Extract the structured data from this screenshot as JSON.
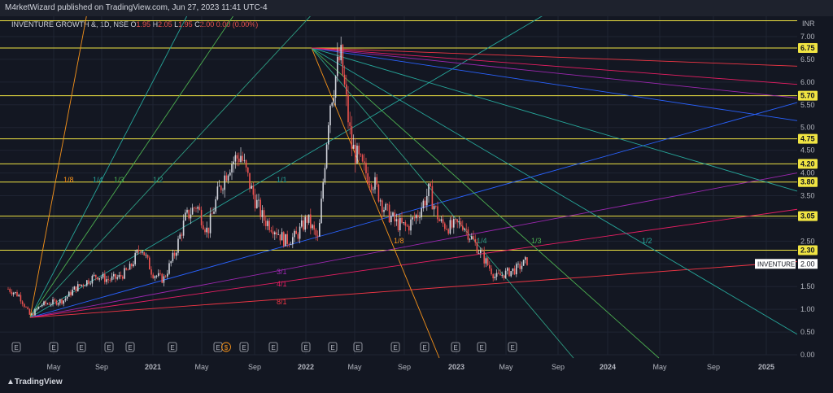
{
  "header": {
    "published": "M4rketWizard published on TradingView.com, Jun 27, 2023 11:41 UTC-4"
  },
  "legend": {
    "symbol": "INVENTURE GROWTH &, 1D, NSE",
    "o_label": "O",
    "o": "1.95",
    "h_label": "H",
    "h": "2.05",
    "l_label": "L",
    "l": "1.95",
    "c_label": "C",
    "c": "2.00",
    "change": "0.00 (0.00%)"
  },
  "footer": {
    "brand": "TradingView"
  },
  "colors": {
    "background": "#131722",
    "up": "#d1d4dc",
    "down": "#ef5350",
    "level": "#f0e442"
  },
  "chart_data": {
    "type": "candlestick",
    "currency": "INR",
    "y_ticks": [
      "0.00",
      "0.50",
      "1.00",
      "1.50",
      "2.00",
      "2.50",
      "3.00",
      "3.50",
      "4.00",
      "4.50",
      "5.00",
      "5.50",
      "6.00",
      "6.50",
      "7.00"
    ],
    "x_ticks": [
      "May",
      "Sep",
      "2021",
      "May",
      "Sep",
      "2022",
      "May",
      "Sep",
      "2023",
      "May",
      "Sep",
      "2024",
      "May",
      "Sep",
      "2025"
    ],
    "ylim": [
      0,
      7.3
    ],
    "grid": true,
    "price_levels": [
      {
        "value": 7.35,
        "label": ""
      },
      {
        "value": 6.75,
        "label": "6.75"
      },
      {
        "value": 5.7,
        "label": "5.70"
      },
      {
        "value": 4.75,
        "label": "4.75"
      },
      {
        "value": 4.2,
        "label": "4.20"
      },
      {
        "value": 3.8,
        "label": "3.80"
      },
      {
        "value": 3.05,
        "label": "3.05"
      },
      {
        "value": 2.3,
        "label": "2.30"
      }
    ],
    "last_price": {
      "symbol": "INVENTURE",
      "value": 2.0,
      "label": "2.00"
    },
    "price_path": [
      1.45,
      1.3,
      0.85,
      1.1,
      1.15,
      1.2,
      1.45,
      1.6,
      1.75,
      1.65,
      1.7,
      1.9,
      2.4,
      1.8,
      1.65,
      2.2,
      3.0,
      3.3,
      2.7,
      3.6,
      4.2,
      4.4,
      3.6,
      3.0,
      2.8,
      2.5,
      2.6,
      3.0,
      2.5,
      5.5,
      6.6,
      4.6,
      4.1,
      3.8,
      3.2,
      2.9,
      2.8,
      3.1,
      3.6,
      2.9,
      2.8,
      2.9,
      2.5,
      2.1,
      1.7,
      1.8,
      1.9,
      2.1
    ],
    "fan_lower": {
      "origin": "2020 Mar low",
      "labels": [
        "1/8",
        "1/4",
        "1/3",
        "1/2",
        "1/1",
        "3/1",
        "4/1",
        "8/1"
      ]
    },
    "fan_upper": {
      "origin": "2022 Jan high",
      "labels": [
        "1/8",
        "1/4",
        "1/3",
        "1/2"
      ]
    },
    "events": [
      "E",
      "E",
      "E",
      "E",
      "E",
      "E",
      "E",
      "E",
      "E",
      "E",
      "E",
      "E",
      "E",
      "E",
      "E",
      "E",
      "E"
    ],
    "dividend_marker": "$"
  }
}
